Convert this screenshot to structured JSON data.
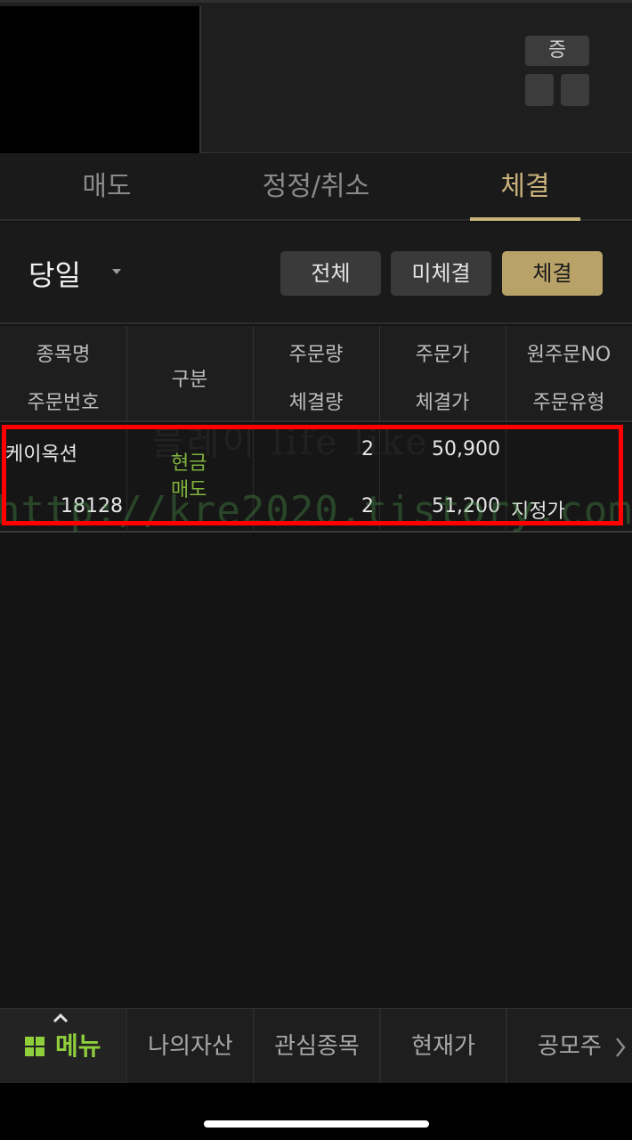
{
  "header": {
    "zeung_label": "증"
  },
  "tabs": [
    {
      "label": "매도"
    },
    {
      "label": "정정/취소"
    },
    {
      "label": "체결"
    }
  ],
  "active_tab": "체결",
  "filter": {
    "date_value": "당일",
    "buttons": [
      {
        "label": "전체"
      },
      {
        "label": "미체결"
      },
      {
        "label": "체결"
      }
    ],
    "active_button": "체결"
  },
  "table": {
    "headers": {
      "name": "종목명",
      "order_no": "주문번호",
      "type": "구분",
      "order_qty": "주문량",
      "filled_qty": "체결량",
      "order_price": "주문가",
      "filled_price": "체결가",
      "orig_order_no": "원주문NO",
      "order_type": "주문유형"
    },
    "rows": [
      {
        "name": "케이옥션",
        "order_no": "18128",
        "type_line1": "현금",
        "type_line2": "매도",
        "order_qty": "2",
        "filled_qty": "2",
        "order_price": "50,900",
        "filled_price": "51,200",
        "orig_order_no": "",
        "order_type": "지정가"
      }
    ]
  },
  "watermarks": {
    "line1": "블레이 life like",
    "line2": "http://kre2020.tistory.com"
  },
  "bottom_nav": [
    {
      "label": "메뉴"
    },
    {
      "label": "나의자산"
    },
    {
      "label": "관심종목"
    },
    {
      "label": "현재가"
    },
    {
      "label": "공모주"
    }
  ],
  "colors": {
    "accent_gold": "#c9b27c",
    "menu_green": "#8fcf3c",
    "type_green": "#7fb33c",
    "highlight_red": "#ff0000"
  }
}
